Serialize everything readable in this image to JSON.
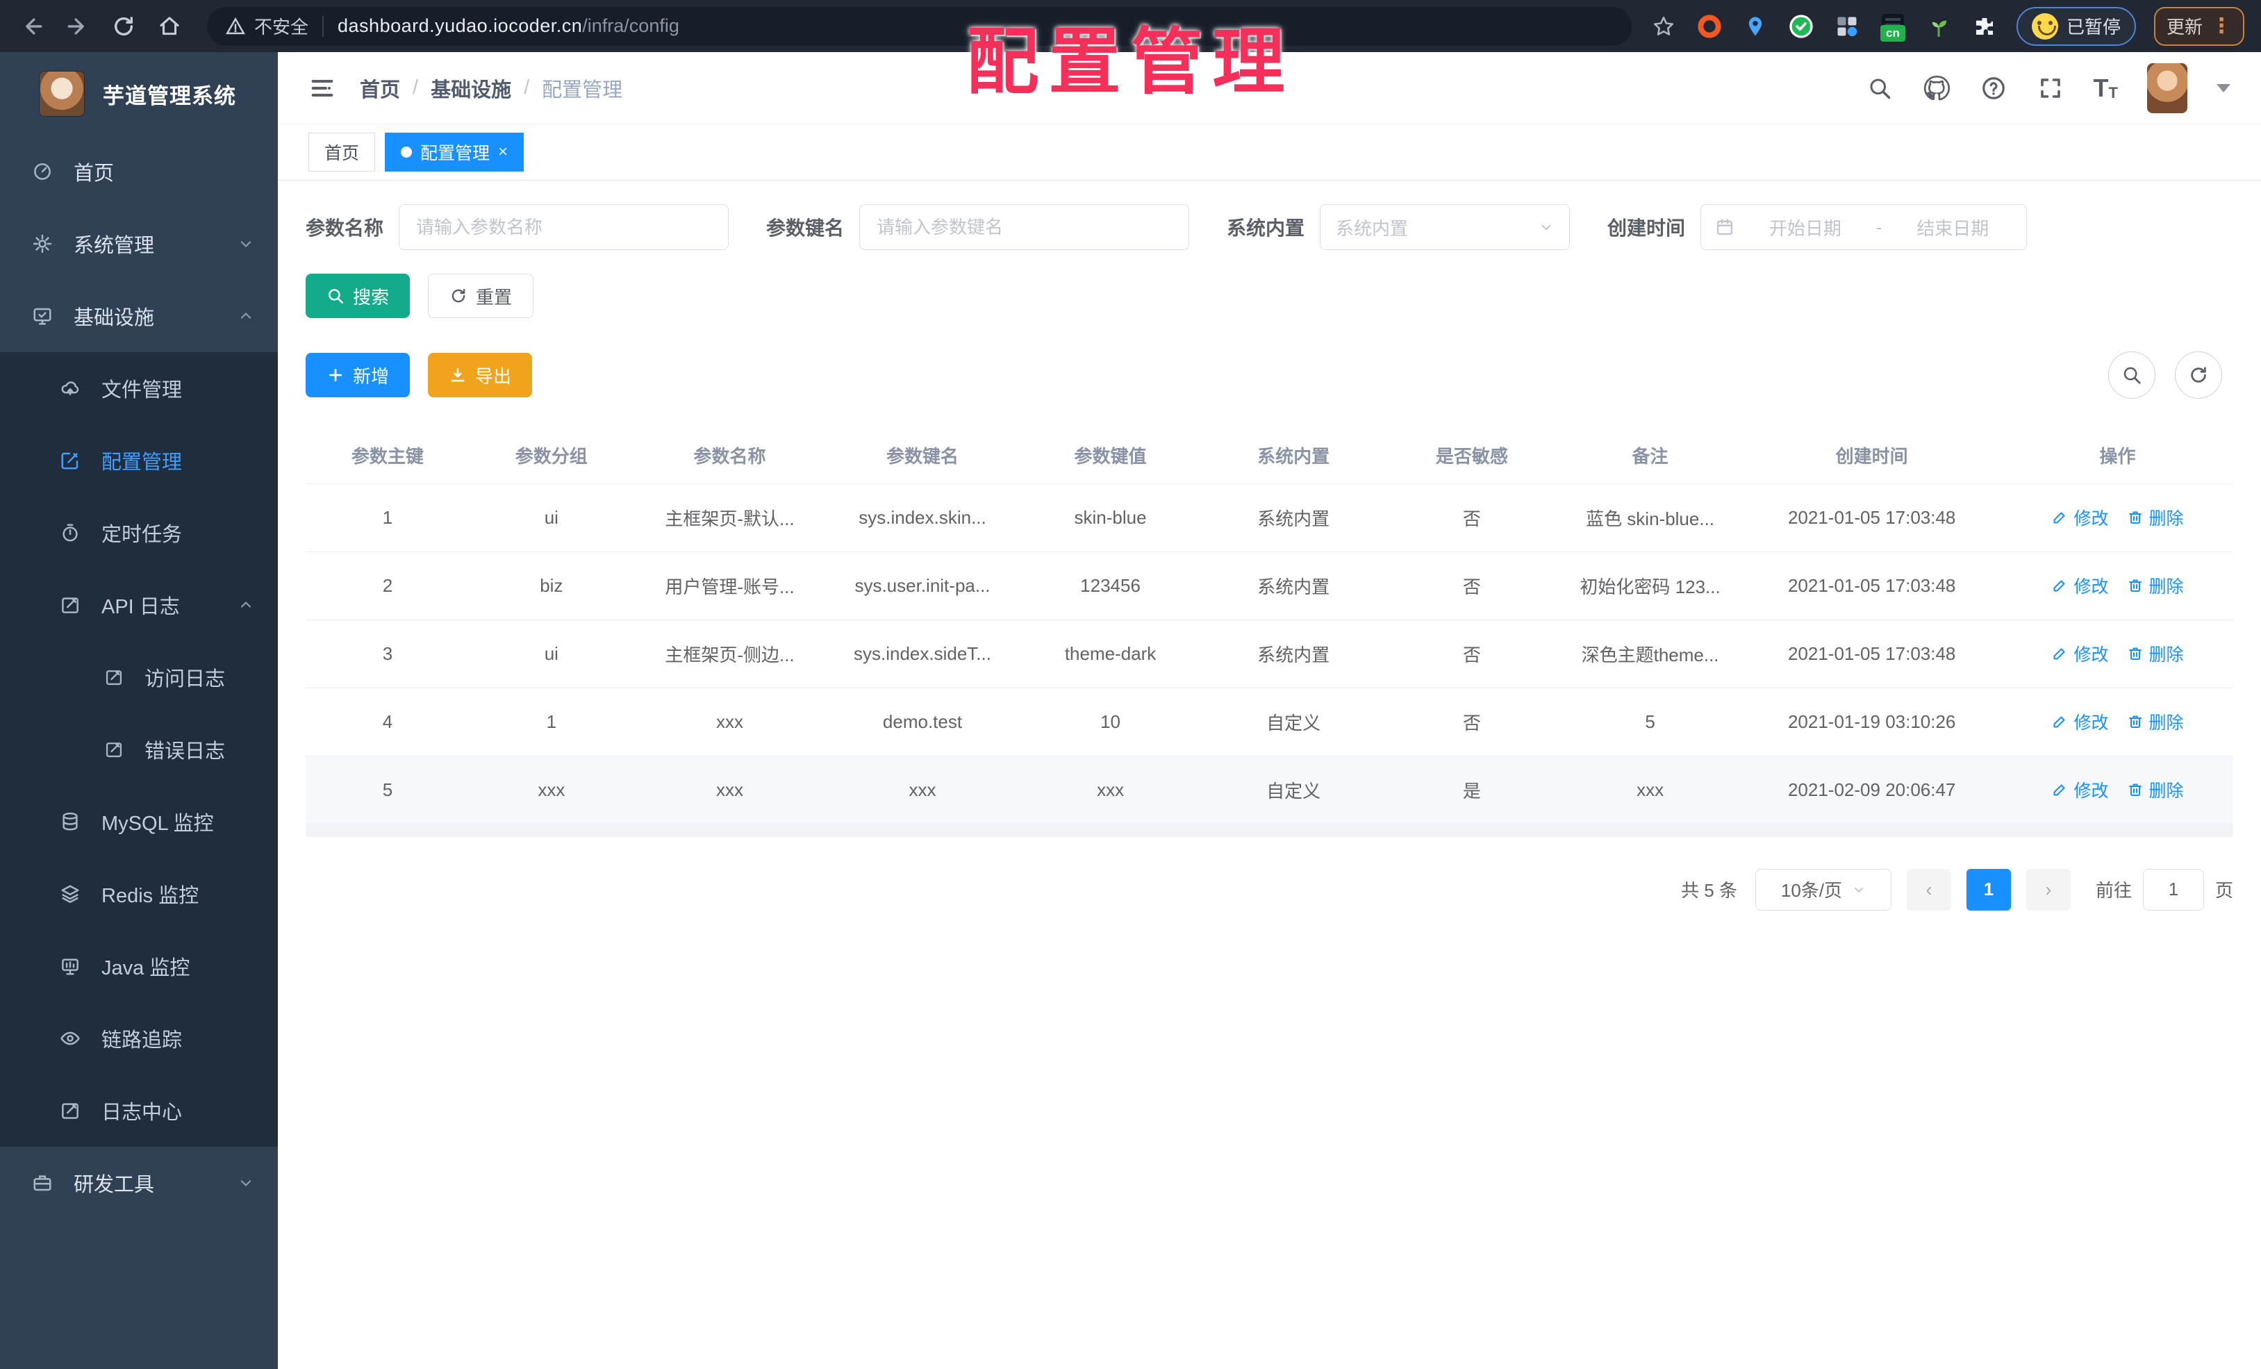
{
  "browser": {
    "security_label": "不安全",
    "url_host": "dashboard.yudao.iocoder.cn",
    "url_path": "/infra/config",
    "cn_badge": "cn",
    "paused_label": "已暂停",
    "update_label": "更新"
  },
  "overlay_title": "配置管理",
  "theme": {
    "primary_blue": "#1890ff",
    "link_blue": "#409eff",
    "teal_search": "#13ab8a",
    "amber_export": "#f0a31c",
    "sidebar_bg": "#304156",
    "submenu_bg": "#1f2d3d",
    "overlay_red": "#f4305a"
  },
  "sidebar": {
    "logo_title": "芋道管理系统",
    "items": [
      {
        "label": "首页"
      },
      {
        "label": "系统管理"
      },
      {
        "label": "基础设施"
      },
      {
        "label": "文件管理"
      },
      {
        "label": "配置管理"
      },
      {
        "label": "定时任务"
      },
      {
        "label": "API 日志"
      },
      {
        "label": "访问日志"
      },
      {
        "label": "错误日志"
      },
      {
        "label": "MySQL 监控"
      },
      {
        "label": "Redis 监控"
      },
      {
        "label": "Java 监控"
      },
      {
        "label": "链路追踪"
      },
      {
        "label": "日志中心"
      },
      {
        "label": "研发工具"
      }
    ]
  },
  "header": {
    "breadcrumb": [
      "首页",
      "基础设施",
      "配置管理"
    ]
  },
  "tags": [
    {
      "label": "首页"
    },
    {
      "label": "配置管理"
    }
  ],
  "filters": {
    "name_label": "参数名称",
    "name_placeholder": "请输入参数名称",
    "key_label": "参数键名",
    "key_placeholder": "请输入参数键名",
    "type_label": "系统内置",
    "type_placeholder": "系统内置",
    "date_label": "创建时间",
    "date_start": "开始日期",
    "date_sep": "-",
    "date_end": "结束日期",
    "search_label": "搜索",
    "reset_label": "重置"
  },
  "toolbar": {
    "add_label": "新增",
    "export_label": "导出"
  },
  "table": {
    "columns": [
      "参数主键",
      "参数分组",
      "参数名称",
      "参数键名",
      "参数键值",
      "系统内置",
      "是否敏感",
      "备注",
      "创建时间",
      "操作"
    ],
    "rows": [
      [
        "1",
        "ui",
        "主框架页-默认...",
        "sys.index.skin...",
        "skin-blue",
        "系统内置",
        "否",
        "蓝色 skin-blue...",
        "2021-01-05 17:03:48"
      ],
      [
        "2",
        "biz",
        "用户管理-账号...",
        "sys.user.init-pa...",
        "123456",
        "系统内置",
        "否",
        "初始化密码 123...",
        "2021-01-05 17:03:48"
      ],
      [
        "3",
        "ui",
        "主框架页-侧边...",
        "sys.index.sideT...",
        "theme-dark",
        "系统内置",
        "否",
        "深色主题theme...",
        "2021-01-05 17:03:48"
      ],
      [
        "4",
        "1",
        "xxx",
        "demo.test",
        "10",
        "自定义",
        "否",
        "5",
        "2021-01-19 03:10:26"
      ],
      [
        "5",
        "xxx",
        "xxx",
        "xxx",
        "xxx",
        "自定义",
        "是",
        "xxx",
        "2021-02-09 20:06:47"
      ]
    ],
    "edit_label": "修改",
    "delete_label": "删除"
  },
  "pagination": {
    "total_label": "共 5 条",
    "page_size_label": "10条/页",
    "current_page": "1",
    "goto_label": "前往",
    "goto_value": "1",
    "page_unit_label": "页"
  }
}
